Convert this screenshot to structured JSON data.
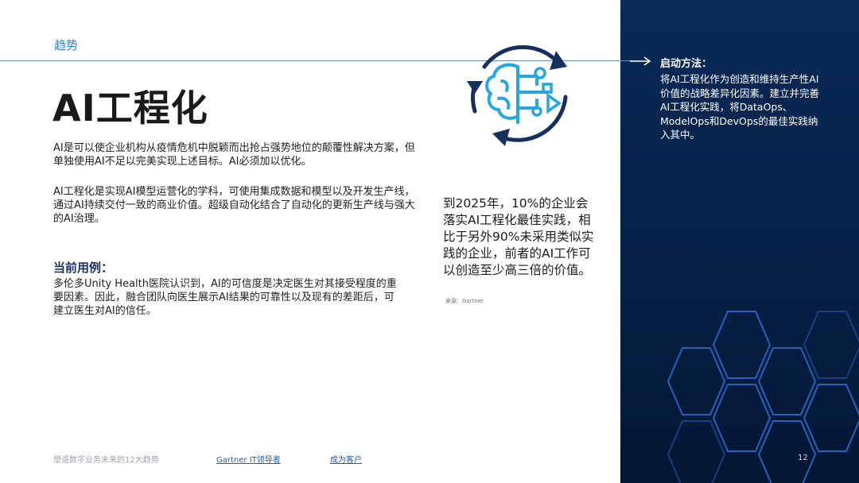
{
  "header": {
    "section": "趋势"
  },
  "title": "AI工程化",
  "intro": {
    "p1": "AI是可以使企业机构从疫情危机中脱颖而出抢占强势地位的颠覆性解决方案，但单独使用AI不足以完美实现上述目标。AI必须加以优化。",
    "p2": "AI工程化是实现AI模型运营化的学科，可使用集成数据和模型以及开发生产线，通过AI持续交付一致的商业价值。超级自动化结合了自动化的更新生产线与强大的AI治理。"
  },
  "use_case": {
    "title": "当前用例：",
    "body": "多伦多Unity Health医院认识到，AI的可信度是决定医生对其接受程度的重要因素。因此，融合团队向医生展示AI结果的可靠性以及现有的差距后，可建立医生对AI的信任。"
  },
  "stat": {
    "text": "到2025年，10%的企业会落实AI工程化最佳实践，相比于另外90%未采用类似实践的企业，前者的AI工作可以创造至少高三倍的价值。",
    "source": "来源：Gartner"
  },
  "panel": {
    "title": "启动方法：",
    "body": "将AI工程化作为创造和维持生产性AI价值的战略差异化因素。建立并完善AI工程化实践，将DataOps、ModelOps和DevOps的最佳实践纳入其中。"
  },
  "footer": {
    "doc_title": "塑造数字业务未来的12大趋势",
    "link1": "Gartner IT领导者",
    "link2": "成为客户",
    "page": "12"
  },
  "colors": {
    "accent_blue": "#2f7fd6",
    "panel_navy": "#062046",
    "icon_light": "#27a6df",
    "icon_dark": "#16305e"
  },
  "icons": [
    "brain-circuit-icon",
    "refresh-cycle-icon",
    "arrow-right-icon",
    "hexagon-pattern"
  ]
}
